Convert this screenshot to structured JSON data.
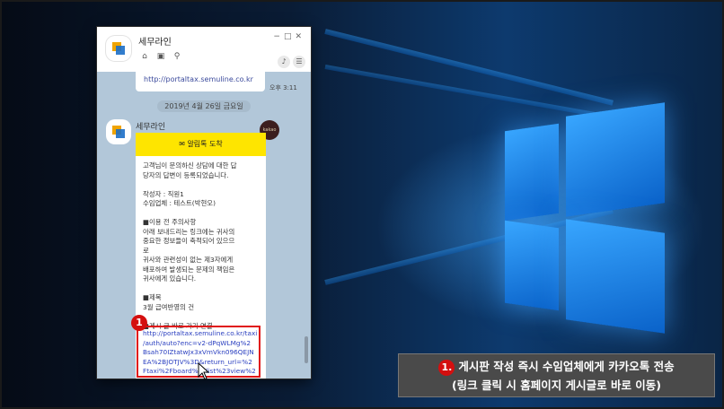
{
  "window": {
    "title": "세무라인",
    "controls": [
      "−",
      "□",
      "✕"
    ],
    "nav_icons": [
      "home-icon",
      "archive-icon",
      "search-icon"
    ],
    "right_icons": [
      "bell-icon",
      "menu-icon"
    ]
  },
  "previous_message": {
    "link": "http://portaltax.semuline.co.kr",
    "time": "오후 3:11"
  },
  "date_separator": "2019년 4월 26일 금요일",
  "message": {
    "sender": "세무라인",
    "badge": "kakao",
    "card_header": "✉ 알림톡 도착",
    "body": "고객님이 문의하신 상담에 대한 답\n당자의 답변이 등록되었습니다.\n\n작성자 : 직원1\n수임업체 : 테스트(박현오)\n\n■이용 전 주의사항\n아래 보내드리는 링크에는 귀사의\n중요한 정보들이 축적되어 있으므\n로\n귀사와 관련성이 없는 제3자에게\n배포하여 발생되는 문제의 책임은\n귀사에게 있습니다.\n\n■제목\n3월 급여반영의 건\n\n■게시 글 바로 가기 연결",
    "link": "http://portaltax.semuline.co.kr/taxi\n/auth/auto?enc=v2-dPqWLMg%2\nBsah70IZtatwJx3xVmVkn096QEJN\nEA%2BJOTJV%3D&return_url=%2\nFtaxi%2Fboard%2Flist%23view%2"
  },
  "annotation_number": "1",
  "caption": {
    "number": "1.",
    "line1": "게시판 작성 즉시 수임업체에게 카카오톡 전송",
    "line2": "(링크 클릭 시 홈페이지 게시글로 바로 이동)"
  },
  "colors": {
    "kakao_yellow": "#fee500",
    "chat_bg": "#b2c7d9",
    "highlight_red": "#e01515",
    "link_blue": "#2a3fc0"
  }
}
